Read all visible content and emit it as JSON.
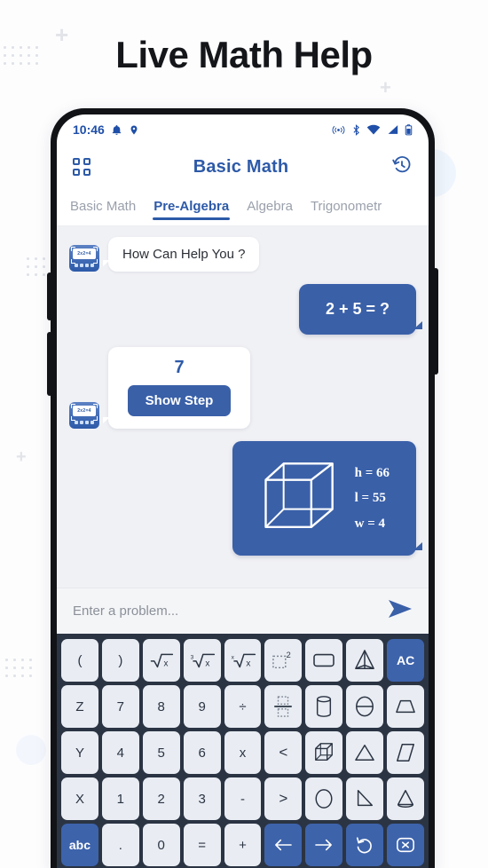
{
  "headline": "Live Math Help",
  "status_bar": {
    "time": "10:46",
    "left_icons": [
      "bell-icon",
      "location-pin-icon"
    ],
    "right_icons": [
      "hotspot-icon",
      "bluetooth-icon",
      "wifi-icon",
      "cellular-signal-icon",
      "battery-icon"
    ]
  },
  "app_bar": {
    "menu_icon": "grid-menu-icon",
    "title": "Basic Math",
    "history_icon": "history-clock-icon"
  },
  "tabs": [
    {
      "label": "Basic Math",
      "active": false
    },
    {
      "label": "Pre-Algebra",
      "active": true
    },
    {
      "label": "Algebra",
      "active": false
    },
    {
      "label": "Trigonometr",
      "active": false
    }
  ],
  "chat": {
    "greeting": "How Can Help You ?",
    "user_question": "2 + 5 = ?",
    "answer_value": "7",
    "show_step_label": "Show Step",
    "cube": {
      "height_label": "h = 66",
      "length_label": "l = 55",
      "width_label": "w = 4"
    },
    "avatar_display": "2x2=4"
  },
  "input": {
    "placeholder": "Enter a problem...",
    "value": "",
    "send_icon": "send-arrow-icon"
  },
  "keyboard": {
    "rows": [
      [
        {
          "name": "paren-open",
          "text": "(",
          "style": "light"
        },
        {
          "name": "paren-close",
          "text": ")",
          "style": "light"
        },
        {
          "name": "square-root",
          "text": "√x",
          "style": "light"
        },
        {
          "name": "cube-root",
          "text": "∛x",
          "style": "light"
        },
        {
          "name": "nth-root",
          "text": "ˣ√x",
          "style": "light"
        },
        {
          "name": "power-two",
          "text": "□²",
          "style": "light"
        },
        {
          "name": "rectangle-shape",
          "text": "▭",
          "style": "light"
        },
        {
          "name": "pyramid-shape",
          "text": "pyramid",
          "style": "light"
        },
        {
          "name": "all-clear",
          "text": "AC",
          "style": "blue"
        }
      ],
      [
        {
          "name": "letter-z",
          "text": "Z",
          "style": "light"
        },
        {
          "name": "digit-7",
          "text": "7",
          "style": "light"
        },
        {
          "name": "digit-8",
          "text": "8",
          "style": "light"
        },
        {
          "name": "digit-9",
          "text": "9",
          "style": "light"
        },
        {
          "name": "divide",
          "text": "÷",
          "style": "light"
        },
        {
          "name": "fraction",
          "text": "fraction",
          "style": "light"
        },
        {
          "name": "cylinder-shape",
          "text": "cylinder",
          "style": "light"
        },
        {
          "name": "sphere-shape",
          "text": "sphere",
          "style": "light"
        },
        {
          "name": "trapezoid-shape",
          "text": "trapezoid",
          "style": "light"
        }
      ],
      [
        {
          "name": "letter-y",
          "text": "Y",
          "style": "light"
        },
        {
          "name": "digit-4",
          "text": "4",
          "style": "light"
        },
        {
          "name": "digit-5",
          "text": "5",
          "style": "light"
        },
        {
          "name": "digit-6",
          "text": "6",
          "style": "light"
        },
        {
          "name": "multiply",
          "text": "x",
          "style": "light"
        },
        {
          "name": "less-than",
          "text": "<",
          "style": "light"
        },
        {
          "name": "cube-shape",
          "text": "cube",
          "style": "light"
        },
        {
          "name": "triangle-shape",
          "text": "triangle",
          "style": "light"
        },
        {
          "name": "parallelogram-shape",
          "text": "parallelogram",
          "style": "light"
        }
      ],
      [
        {
          "name": "letter-x",
          "text": "X",
          "style": "light"
        },
        {
          "name": "digit-1",
          "text": "1",
          "style": "light"
        },
        {
          "name": "digit-2",
          "text": "2",
          "style": "light"
        },
        {
          "name": "digit-3",
          "text": "3",
          "style": "light"
        },
        {
          "name": "minus",
          "text": "-",
          "style": "light"
        },
        {
          "name": "greater-than",
          "text": ">",
          "style": "light"
        },
        {
          "name": "circle-shape",
          "text": "circle",
          "style": "light"
        },
        {
          "name": "right-triangle-shape",
          "text": "right-triangle",
          "style": "light"
        },
        {
          "name": "cone-shape",
          "text": "cone",
          "style": "light"
        }
      ],
      [
        {
          "name": "abc-toggle",
          "text": "abc",
          "style": "blue"
        },
        {
          "name": "decimal-point",
          "text": ".",
          "style": "light"
        },
        {
          "name": "digit-0",
          "text": "0",
          "style": "light"
        },
        {
          "name": "equals",
          "text": "=",
          "style": "light"
        },
        {
          "name": "plus",
          "text": "+",
          "style": "light"
        },
        {
          "name": "cursor-left",
          "text": "←",
          "style": "blue"
        },
        {
          "name": "cursor-right",
          "text": "→",
          "style": "blue"
        },
        {
          "name": "undo",
          "text": "↺",
          "style": "blue"
        },
        {
          "name": "backspace",
          "text": "⌫",
          "style": "blue"
        }
      ]
    ]
  },
  "colors": {
    "brand_blue": "#3a60a8",
    "title_blue": "#2d5aa8",
    "keyboard_bg": "#2b3443",
    "key_light": "#e9edf3",
    "chat_bg": "#f0f1f5"
  }
}
